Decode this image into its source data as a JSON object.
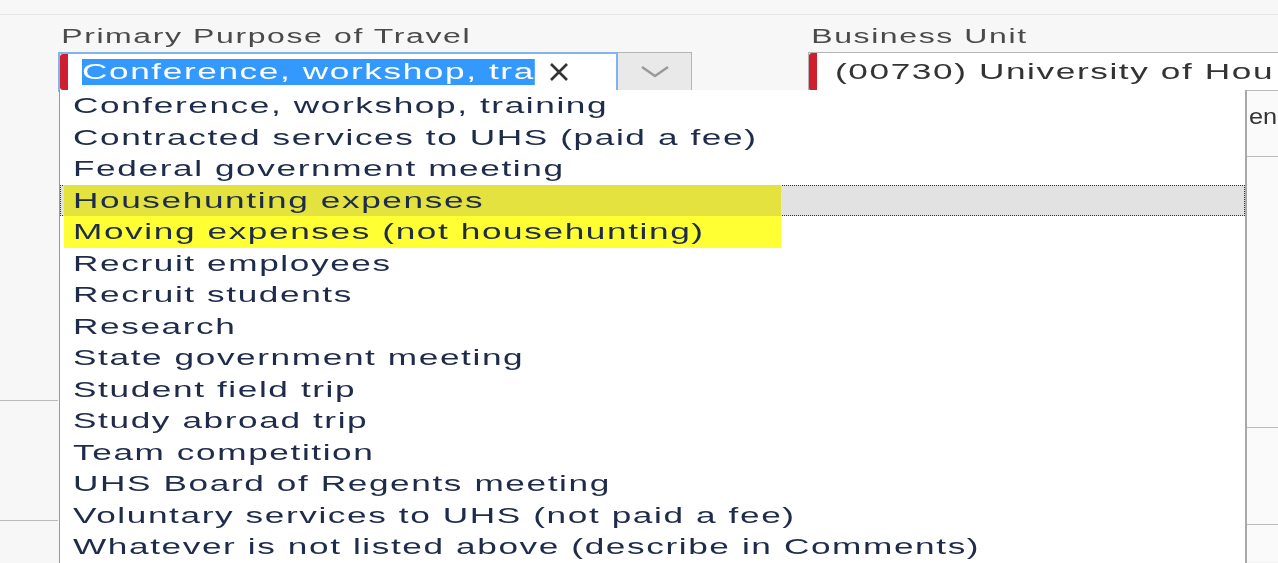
{
  "purpose_field": {
    "label": "Primary Purpose of Travel",
    "value": "Conference, workshop, tra",
    "value_selected": true,
    "required": true,
    "focused": true
  },
  "business_unit_field": {
    "label": "Business Unit",
    "value": "(00730) University of Hou",
    "required": true
  },
  "partial_text": "en",
  "purpose_options": [
    {
      "label": "Conference, workshop, training",
      "hovered": false,
      "highlighted": false
    },
    {
      "label": "Contracted services to UHS (paid a fee)",
      "hovered": false,
      "highlighted": false
    },
    {
      "label": "Federal government meeting",
      "hovered": false,
      "highlighted": false
    },
    {
      "label": "Househunting expenses",
      "hovered": true,
      "highlighted": true
    },
    {
      "label": "Moving expenses (not househunting)",
      "hovered": false,
      "highlighted": true
    },
    {
      "label": "Recruit employees",
      "hovered": false,
      "highlighted": false
    },
    {
      "label": "Recruit students",
      "hovered": false,
      "highlighted": false
    },
    {
      "label": "Research",
      "hovered": false,
      "highlighted": false
    },
    {
      "label": "State government meeting",
      "hovered": false,
      "highlighted": false
    },
    {
      "label": "Student field trip",
      "hovered": false,
      "highlighted": false
    },
    {
      "label": "Study abroad trip",
      "hovered": false,
      "highlighted": false
    },
    {
      "label": "Team competition",
      "hovered": false,
      "highlighted": false
    },
    {
      "label": "UHS Board of Regents meeting",
      "hovered": false,
      "highlighted": false
    },
    {
      "label": "Voluntary services to UHS (not paid a fee)",
      "hovered": false,
      "highlighted": false
    },
    {
      "label": "Whatever is not listed above (describe in Comments)",
      "hovered": false,
      "highlighted": false
    }
  ]
}
